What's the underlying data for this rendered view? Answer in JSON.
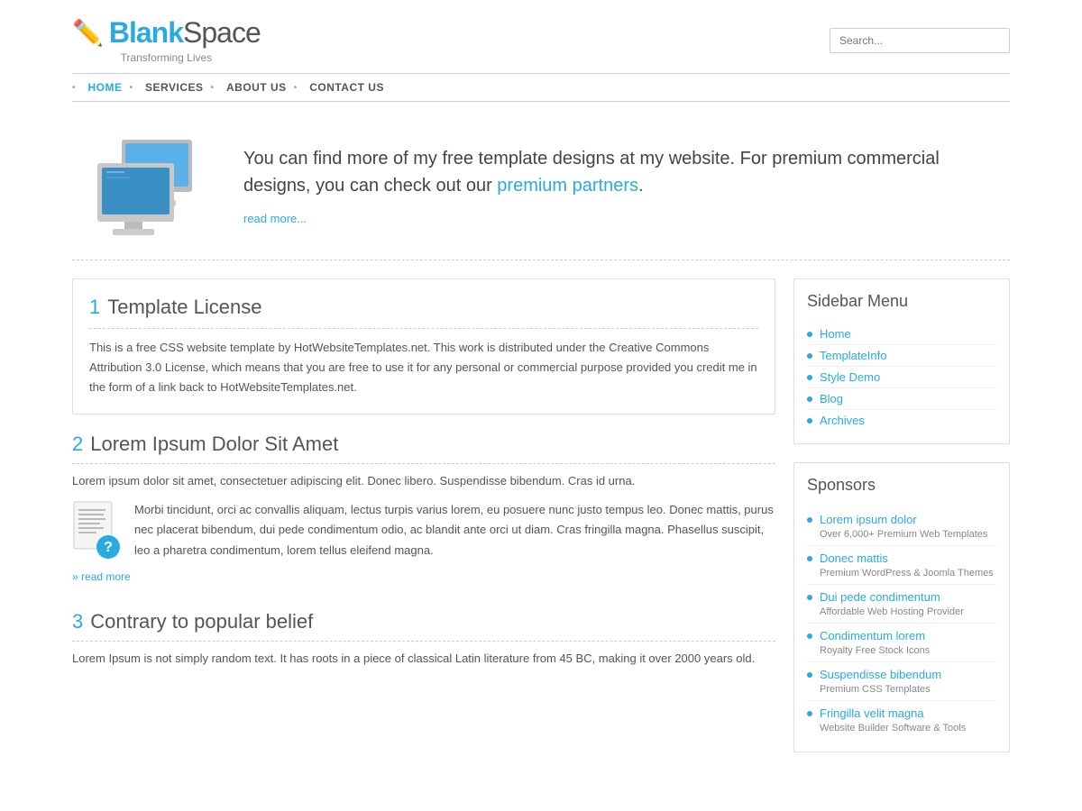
{
  "header": {
    "logo_blank": "Blank",
    "logo_space": "Space",
    "tagline": "Transforming Lives",
    "search_placeholder": "Search..."
  },
  "nav": {
    "items": [
      {
        "label": "HOME",
        "active": true
      },
      {
        "label": "SERVICES",
        "active": false
      },
      {
        "label": "ABOUT US",
        "active": false
      },
      {
        "label": "CONTACT US",
        "active": false
      }
    ]
  },
  "hero": {
    "text_before": "You can find more of my free template designs at my website. For premium commercial designs, you can check out our ",
    "link_text": "premium partners",
    "text_after": ".",
    "read_more": "read more..."
  },
  "content_box": {
    "number": "1",
    "title": "Template License",
    "body": "This is a free CSS website template by HotWebsiteTemplates.net. This work is distributed under the Creative Commons Attribution 3.0 License, which means that you are free to use it for any personal or commercial purpose provided you credit me in the form of a link back to HotWebsiteTemplates.net."
  },
  "post2": {
    "number": "2",
    "title": "Lorem Ipsum Dolor Sit Amet",
    "body": "Lorem ipsum dolor sit amet, consectetuer adipiscing elit. Donec libero. Suspendisse bibendum. Cras id urna.",
    "thumb_text": "Morbi tincidunt, orci ac convallis aliquam, lectus turpis varius lorem, eu posuere nunc justo tempus leo. Donec mattis, purus nec placerat bibendum, dui pede condimentum odio, ac blandit ante orci ut diam. Cras fringilla magna. Phasellus suscipit, leo a pharetra condimentum, lorem tellus eleifend magna.",
    "read_more": "» read more"
  },
  "post3": {
    "number": "3",
    "title": "Contrary to popular belief",
    "body": "Lorem Ipsum is not simply random text. It has roots in a piece of classical Latin literature from 45 BC, making it over 2000 years old."
  },
  "sidebar_menu": {
    "title": "Sidebar Menu",
    "items": [
      {
        "label": "Home"
      },
      {
        "label": "TemplateInfo"
      },
      {
        "label": "Style Demo"
      },
      {
        "label": "Blog"
      },
      {
        "label": "Archives"
      }
    ]
  },
  "sponsors": {
    "title": "Sponsors",
    "items": [
      {
        "name": "Lorem ipsum dolor",
        "desc": "Over 6,000+ Premium Web Templates"
      },
      {
        "name": "Donec mattis",
        "desc": "Premium WordPress & Joomla Themes"
      },
      {
        "name": "Dui pede condimentum",
        "desc": "Affordable Web Hosting Provider"
      },
      {
        "name": "Condimentum lorem",
        "desc": "Royalty Free Stock Icons"
      },
      {
        "name": "Suspendisse bibendum",
        "desc": "Premium CSS Templates"
      },
      {
        "name": "Fringilla velit magna",
        "desc": "Website Builder Software & Tools"
      }
    ]
  }
}
